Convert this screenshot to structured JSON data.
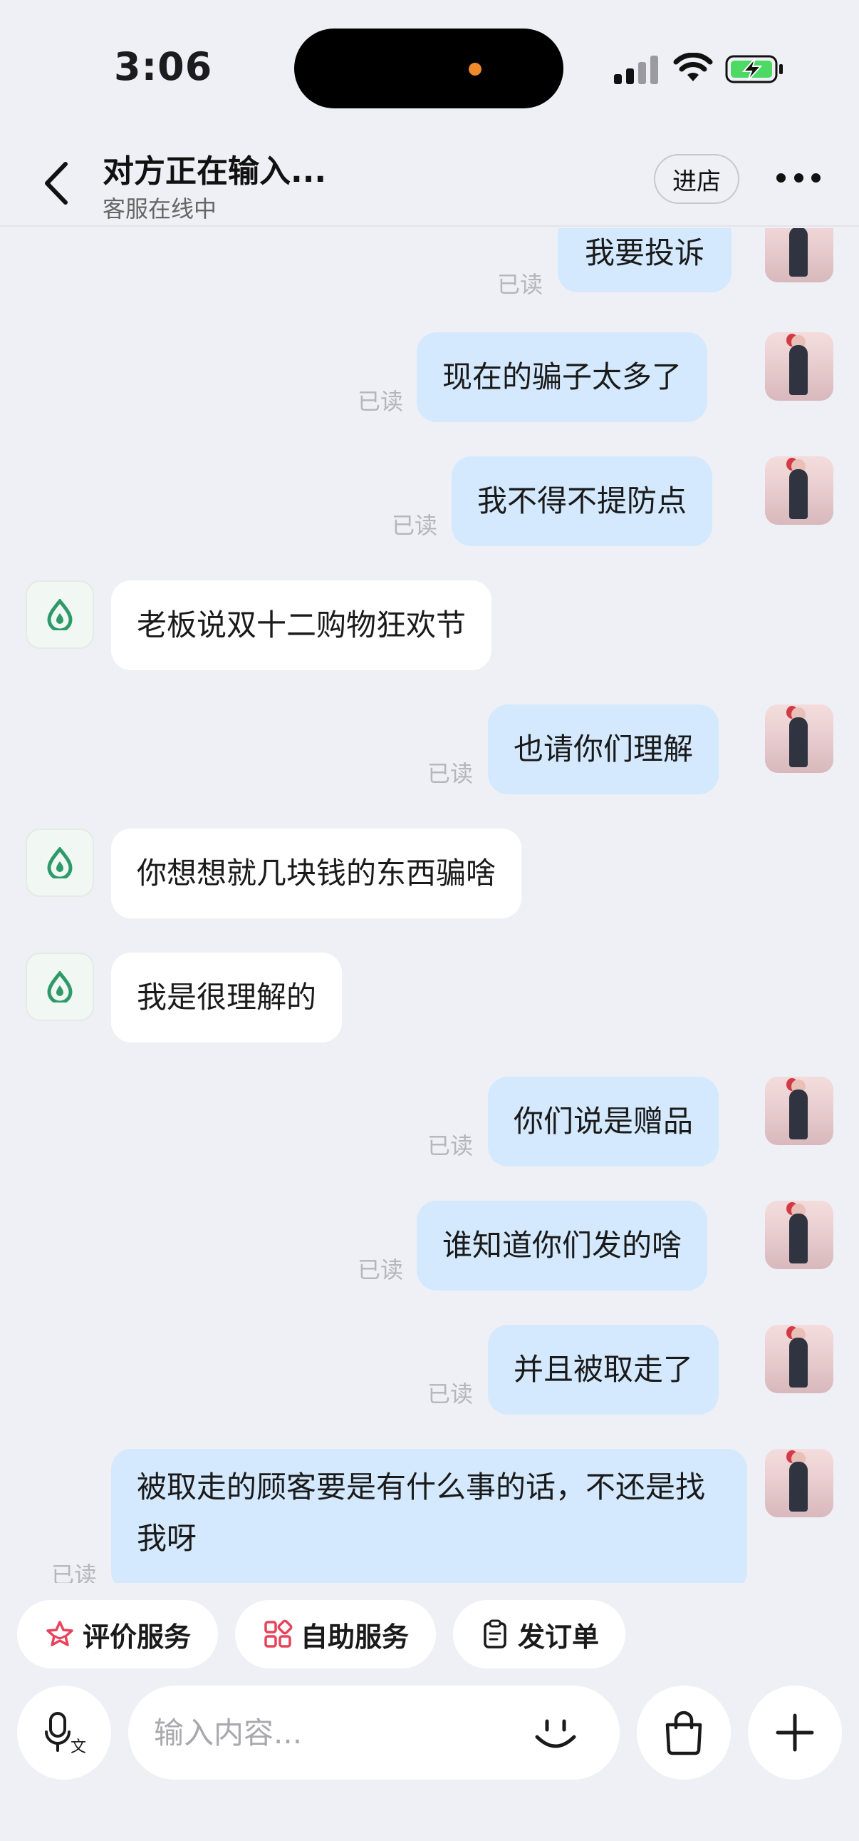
{
  "status_bar": {
    "time": "3:06"
  },
  "header": {
    "title": "对方正在输入...",
    "subtitle": "客服在线中",
    "shop_button": "进店"
  },
  "messages": [
    {
      "from": "me",
      "text": "我要投诉",
      "read": "已读"
    },
    {
      "from": "me",
      "text": "现在的骗子太多了",
      "read": "已读"
    },
    {
      "from": "me",
      "text": "我不得不提防点",
      "read": "已读"
    },
    {
      "from": "other",
      "text": "老板说双十二购物狂欢节"
    },
    {
      "from": "me",
      "text": "也请你们理解",
      "read": "已读"
    },
    {
      "from": "other",
      "text": "你想想就几块钱的东西骗啥"
    },
    {
      "from": "other",
      "text": "我是很理解的"
    },
    {
      "from": "me",
      "text": "你们说是赠品",
      "read": "已读"
    },
    {
      "from": "me",
      "text": "谁知道你们发的啥",
      "read": "已读"
    },
    {
      "from": "me",
      "text": "并且被取走了",
      "read": "已读"
    },
    {
      "from": "me",
      "text": "被取走的顾客要是有什么事的话，不还是找我呀",
      "read": "已读"
    }
  ],
  "quick_actions": [
    {
      "label": "评价服务",
      "icon": "star-icon"
    },
    {
      "label": "自助服务",
      "icon": "grid-icon"
    },
    {
      "label": "发订单",
      "icon": "clipboard-icon"
    }
  ],
  "input": {
    "placeholder": "输入内容..."
  },
  "colors": {
    "my_bubble": "#d4e9fd",
    "other_bubble": "#ffffff",
    "background": "#eef0f5",
    "bot_logo": "#2e9a6a"
  }
}
